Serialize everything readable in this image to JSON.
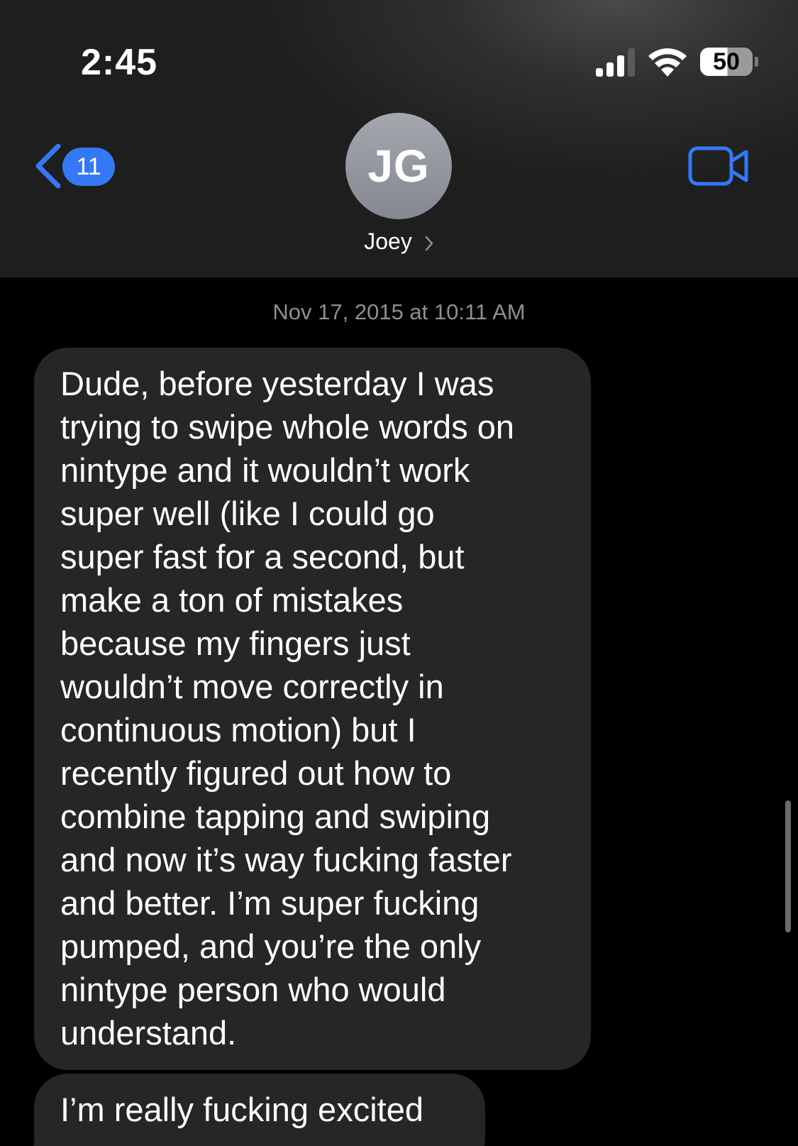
{
  "status_bar": {
    "time": "2:45",
    "battery_level": "50",
    "signal_icon": "cellular-signal-icon",
    "wifi_icon": "wifi-icon",
    "battery_icon": "battery-icon"
  },
  "header": {
    "back_badge_count": "11",
    "back_icon": "chevron-left-icon",
    "avatar_initials": "JG",
    "contact_name": "Joey",
    "contact_chevron_icon": "chevron-right-icon",
    "video_icon": "video-camera-icon"
  },
  "conversation": {
    "timestamp": "Nov 17, 2015 at 10:11 AM",
    "messages": [
      {
        "lines": [
          "Dude, before yesterday I was",
          "trying to swipe whole words on",
          "nintype and it wouldn’t work",
          "super well (like I could go",
          "super fast for a second, but",
          "make a ton of mistakes",
          "because my fingers just",
          "wouldn’t move correctly in",
          "continuous motion) but I",
          "recently figured out how to",
          "combine tapping and swiping",
          "and now it’s way fucking faster",
          "and better. I’m super fucking",
          "pumped, and you’re the only",
          "nintype person who would",
          "understand."
        ]
      },
      {
        "text": "I’m really fucking excited"
      }
    ]
  },
  "colors": {
    "accent": "#3478f6",
    "bubble_incoming": "#262628",
    "timestamp_gray": "#8e8e93",
    "background": "#000000"
  }
}
